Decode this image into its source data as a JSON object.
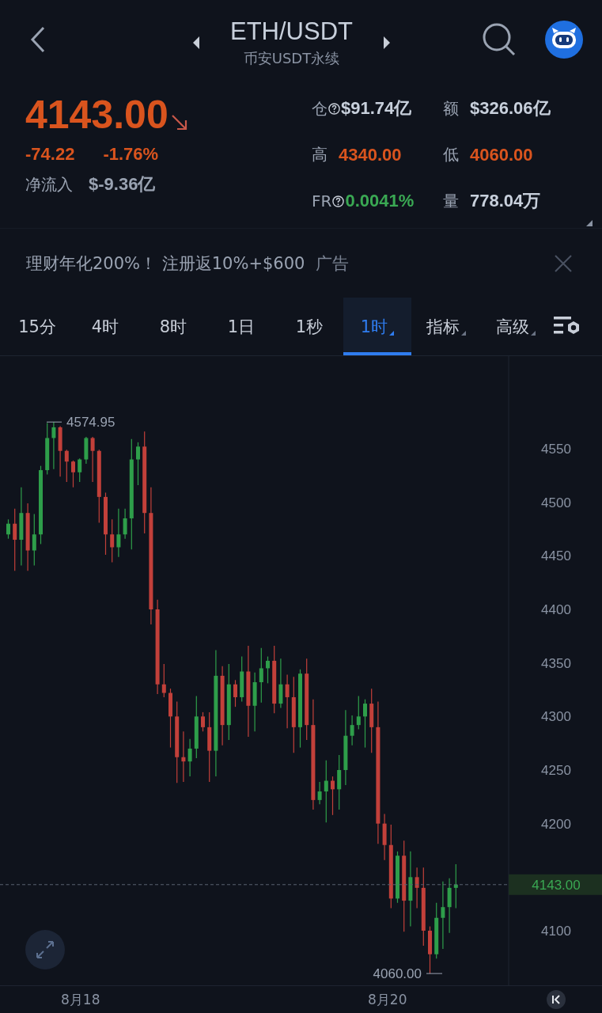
{
  "header": {
    "title": "ETH/USDT",
    "subtitle": "币安USDT永续"
  },
  "price": {
    "last": "4143.00",
    "falling": true,
    "change": "-74.22",
    "change_pct": "-1.76%",
    "net_inflow_label": "净流入",
    "net_inflow_value": "$-9.36亿"
  },
  "stats": [
    {
      "label": "仓",
      "help": true,
      "value": "$91.74亿",
      "kind": "neutral"
    },
    {
      "label": "额",
      "help": false,
      "value": "$326.06亿",
      "kind": "neutral"
    },
    {
      "label": "高",
      "help": false,
      "value": "4340.00",
      "kind": "down"
    },
    {
      "label": "低",
      "help": false,
      "value": "4060.00",
      "kind": "down"
    },
    {
      "label": "FR",
      "help": true,
      "value": "0.0041%",
      "kind": "up"
    },
    {
      "label": "量",
      "help": false,
      "value": "778.04万",
      "kind": "neutral"
    }
  ],
  "ad": {
    "text": "理财年化200%！ 注册返10%+$600",
    "tag": "广告"
  },
  "tabs": [
    {
      "label": "15分",
      "selected": false,
      "menu": false
    },
    {
      "label": "4时",
      "selected": false,
      "menu": false
    },
    {
      "label": "8时",
      "selected": false,
      "menu": false
    },
    {
      "label": "1日",
      "selected": false,
      "menu": false
    },
    {
      "label": "1秒",
      "selected": false,
      "menu": false
    },
    {
      "label": "1时",
      "selected": true,
      "menu": true
    },
    {
      "label": "指标",
      "selected": false,
      "menu": true
    },
    {
      "label": "高级",
      "selected": false,
      "menu": true
    }
  ],
  "chart": {
    "y_ticks": [
      "4550",
      "4500",
      "4450",
      "4400",
      "4350",
      "4300",
      "4250",
      "4200",
      "4100"
    ],
    "x_labels": [
      "8月18",
      "8月20"
    ],
    "high_label": "4574.95",
    "low_label": "4060.00",
    "current_price": "4143.00"
  }
}
